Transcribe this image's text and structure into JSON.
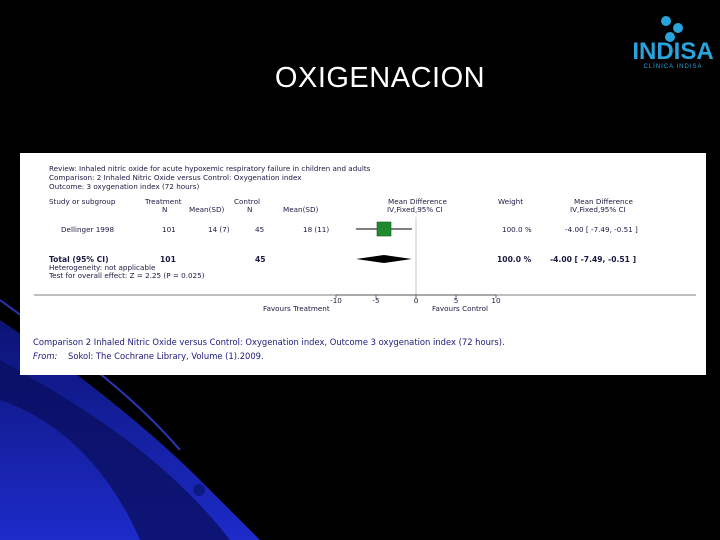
{
  "slide": {
    "title": "OXIGENACION"
  },
  "logo": {
    "text": "INDISA",
    "subtext": "CLÍNICA INDISA"
  },
  "review": {
    "review_line": "Review:  Inhaled nitric oxide for acute hypoxemic respiratory failure in children and adults",
    "comparison_line": "Comparison:  2 Inhaled Nitric Oxide versus Control: Oxygenation index",
    "outcome_line": "Outcome:  3 oxygenation index (72 hours)"
  },
  "columns": {
    "study": "Study or subgroup",
    "treatment": "Treatment",
    "treatment_n": "N",
    "treatment_mean": "Mean(SD)",
    "control": "Control",
    "control_n": "N",
    "control_mean": "Mean(SD)",
    "md": "Mean Difference",
    "md_method": "IV,Fixed,95% CI",
    "weight": "Weight",
    "md2": "Mean Difference",
    "md2_method": "IV,Fixed,95% CI"
  },
  "rows": [
    {
      "study": "Dellinger 1998",
      "t_n": "101",
      "t_mean": "14 (7)",
      "c_n": "45",
      "c_mean": "18 (11)",
      "weight": "100.0 %",
      "ci": "-4.00 [ -7.49, -0.51 ]"
    }
  ],
  "total": {
    "label": "Total (95% CI)",
    "t_n": "101",
    "c_n": "45",
    "weight": "100.0 %",
    "ci": "-4.00 [ -7.49, -0.51 ]",
    "heterogeneity": "Heterogeneity: not applicable",
    "overall": "Test for overall effect: Z = 2.25 (P = 0.025)"
  },
  "axis": {
    "favours_left": "Favours Treatment",
    "favours_right": "Favours Control"
  },
  "caption": {
    "line1": "Comparison 2 Inhaled Nitric Oxide versus Control: Oxygenation index, Outcome 3 oxygenation index (72 hours).",
    "from_label": "From:",
    "from_text": "Sokol: The Cochrane Library, Volume (1).2009."
  },
  "colors": {
    "square": "#1e8a2e",
    "diamond": "#000000",
    "text": "#1a1a40",
    "caption": "#1a1a7a"
  },
  "chart_data": {
    "type": "forest",
    "studies": [
      {
        "name": "Dellinger 1998",
        "estimate": -4.0,
        "ci_low": -7.49,
        "ci_high": -0.51,
        "weight": 100.0
      }
    ],
    "pooled": {
      "estimate": -4.0,
      "ci_low": -7.49,
      "ci_high": -0.51
    },
    "xticks": [
      -10,
      -5,
      0,
      5,
      10
    ],
    "xlim": [
      -10,
      10
    ]
  }
}
